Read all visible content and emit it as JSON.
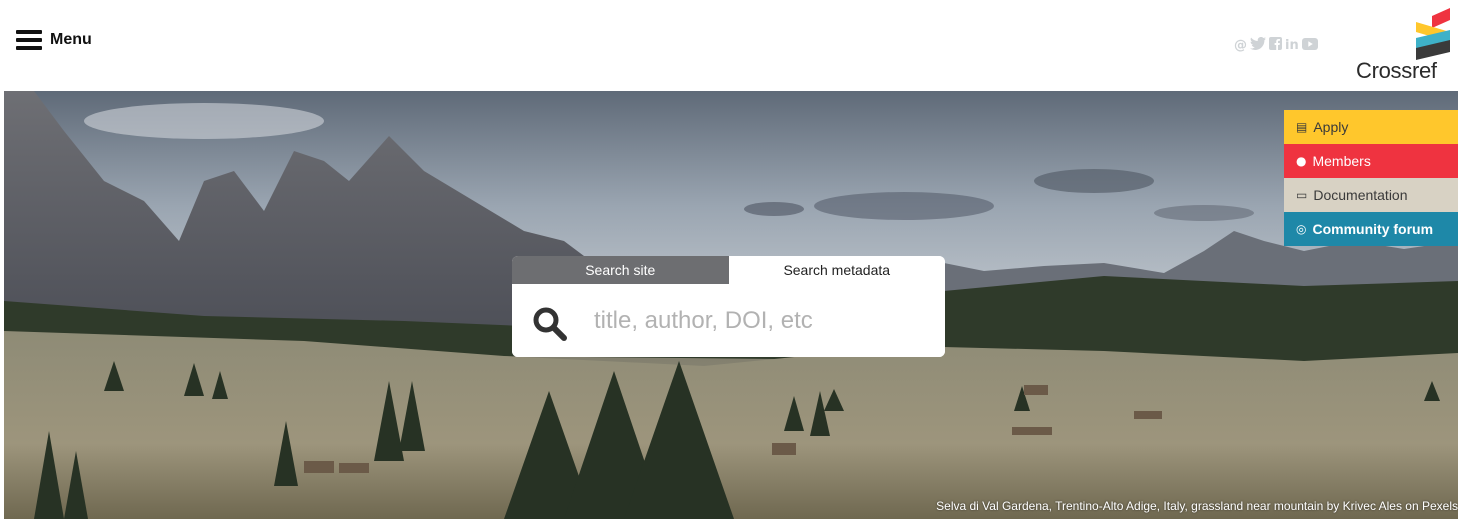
{
  "header": {
    "menu_label": "Menu",
    "social_icons": [
      "at-icon",
      "twitter-icon",
      "facebook-icon",
      "linkedin-icon",
      "youtube-icon"
    ],
    "logo_text": "Crossref"
  },
  "quick_links": [
    {
      "label": "Apply",
      "icon": "form-icon",
      "color": "#ffc72c"
    },
    {
      "label": "Members",
      "icon": "person-icon",
      "color": "#ef3340"
    },
    {
      "label": "Documentation",
      "icon": "chat-icon",
      "color": "#d8d2c4"
    },
    {
      "label": "Community forum",
      "icon": "speech-bubbles-icon",
      "color": "#1e88a8"
    }
  ],
  "search": {
    "tab_site": "Search site",
    "tab_metadata": "Search metadata",
    "placeholder": "title, author, DOI, etc",
    "value": ""
  },
  "hero": {
    "caption": "Selva di Val Gardena, Trentino-Alto Adige, Italy, grassland near mountain by Krivec Ales on Pexels"
  }
}
